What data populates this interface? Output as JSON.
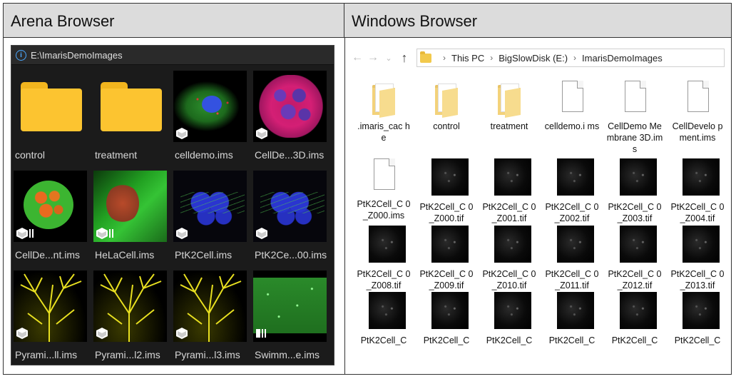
{
  "headers": {
    "left": "Arena Browser",
    "right": "Windows Browser"
  },
  "arena": {
    "path": "E:\\ImarisDemoImages",
    "tiles": [
      {
        "label": "control"
      },
      {
        "label": "treatment"
      },
      {
        "label": "celldemo.ims"
      },
      {
        "label": "CellDe...3D.ims"
      },
      {
        "label": "CellDe...nt.ims"
      },
      {
        "label": "HeLaCell.ims"
      },
      {
        "label": "PtK2Cell.ims"
      },
      {
        "label": "PtK2Ce...00.ims"
      },
      {
        "label": "Pyrami...ll.ims"
      },
      {
        "label": "Pyrami...l2.ims"
      },
      {
        "label": "Pyrami...l3.ims"
      },
      {
        "label": "Swimm...e.ims"
      }
    ]
  },
  "windows": {
    "breadcrumb": [
      "This PC",
      "BigSlowDisk (E:)",
      "ImarisDemoImages"
    ],
    "items": [
      {
        "label": ".imaris_cac he"
      },
      {
        "label": "control"
      },
      {
        "label": "treatment"
      },
      {
        "label": "celldemo.i ms"
      },
      {
        "label": "CellDemo Membrane 3D.ims"
      },
      {
        "label": "CellDevelo pment.ims"
      },
      {
        "label": "PtK2Cell_C 0_Z000.ims"
      },
      {
        "label": "PtK2Cell_C 0_Z000.tif"
      },
      {
        "label": "PtK2Cell_C 0_Z001.tif"
      },
      {
        "label": "PtK2Cell_C 0_Z002.tif"
      },
      {
        "label": "PtK2Cell_C 0_Z003.tif"
      },
      {
        "label": "PtK2Cell_C 0_Z004.tif"
      },
      {
        "label": "PtK2Cell_C 0_Z008.tif"
      },
      {
        "label": "PtK2Cell_C 0_Z009.tif"
      },
      {
        "label": "PtK2Cell_C 0_Z010.tif"
      },
      {
        "label": "PtK2Cell_C 0_Z011.tif"
      },
      {
        "label": "PtK2Cell_C 0_Z012.tif"
      },
      {
        "label": "PtK2Cell_C 0_Z013.tif"
      },
      {
        "label": "PtK2Cell_C"
      },
      {
        "label": "PtK2Cell_C"
      },
      {
        "label": "PtK2Cell_C"
      },
      {
        "label": "PtK2Cell_C"
      },
      {
        "label": "PtK2Cell_C"
      },
      {
        "label": "PtK2Cell_C"
      }
    ]
  }
}
